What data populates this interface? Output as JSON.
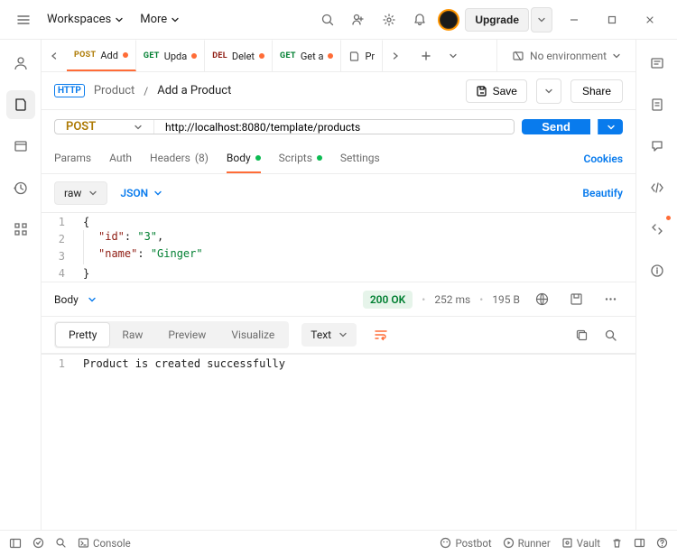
{
  "topbar": {
    "workspaces": "Workspaces",
    "more": "More",
    "upgrade": "Upgrade"
  },
  "tabs": [
    {
      "method": "POST",
      "method_class": "m-post",
      "label": "Add",
      "dirty": true,
      "active": true
    },
    {
      "method": "GET",
      "method_class": "m-get",
      "label": "Upda",
      "dirty": true
    },
    {
      "method": "DEL",
      "method_class": "m-del",
      "label": "Delet",
      "dirty": true
    },
    {
      "method": "GET",
      "method_class": "m-get",
      "label": "Get a",
      "dirty": true
    },
    {
      "method": "",
      "method_class": "",
      "label": "Pr",
      "icon": "collection"
    }
  ],
  "env": {
    "label": "No environment"
  },
  "crumb": {
    "parent": "Product",
    "current": "Add a Product",
    "save": "Save",
    "share": "Share"
  },
  "request": {
    "method": "POST",
    "url": "http://localhost:8080/template/products",
    "send": "Send"
  },
  "reqTabs": {
    "params": "Params",
    "auth": "Auth",
    "headers": "Headers",
    "headers_count": "(8)",
    "body": "Body",
    "scripts": "Scripts",
    "settings": "Settings",
    "cookies": "Cookies"
  },
  "bodyOpts": {
    "raw": "raw",
    "json": "JSON",
    "beautify": "Beautify"
  },
  "reqBodyLines": [
    "{",
    "    \"id\": \"3\",",
    "    \"name\": \"Ginger\"",
    "}"
  ],
  "response": {
    "tab": "Body",
    "status": "200 OK",
    "time": "252 ms",
    "size": "195 B",
    "viewTabs": {
      "pretty": "Pretty",
      "raw": "Raw",
      "preview": "Preview",
      "visualize": "Visualize"
    },
    "type": "Text",
    "body": "Product is created successfully"
  },
  "statusbar": {
    "console": "Console",
    "postbot": "Postbot",
    "runner": "Runner",
    "vault": "Vault"
  }
}
